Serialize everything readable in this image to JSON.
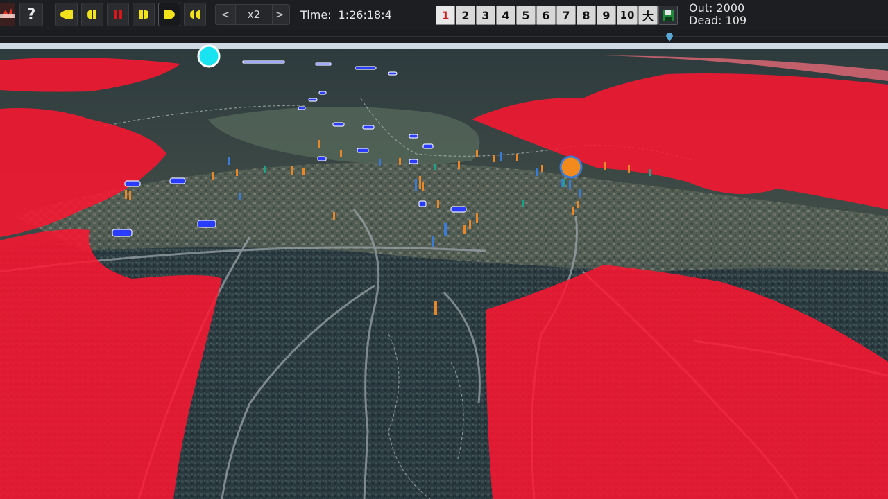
{
  "toolbar": {
    "help_label": "?",
    "speed": {
      "prev_label": "<",
      "value": "x2",
      "next_label": ">"
    },
    "time": {
      "label": "Time:",
      "value": "1:26:18:4"
    },
    "views": [
      "1",
      "2",
      "3",
      "4",
      "5",
      "6",
      "7",
      "8",
      "9",
      "10",
      "大"
    ],
    "selected_view": "1",
    "stats": {
      "out_label": "Out:",
      "out_value": "2000",
      "dead_label": "Dead:",
      "dead_value": "109"
    }
  },
  "playback_icons": [
    "rewind-icon",
    "step-back-icon",
    "pause-icon",
    "step-forward-icon",
    "play-icon",
    "fast-forward-icon"
  ],
  "colors": {
    "playback_icon": "#f2e21c",
    "pause_icon": "#d81818",
    "fire_zone": "#ff1530",
    "vehicle": "#2a3cff",
    "marker_cyan": "#19e3f0",
    "marker_orange": "#f28a1e",
    "evacuee_orange": "#e8862a",
    "evacuee_blue": "#3a7bd5"
  }
}
